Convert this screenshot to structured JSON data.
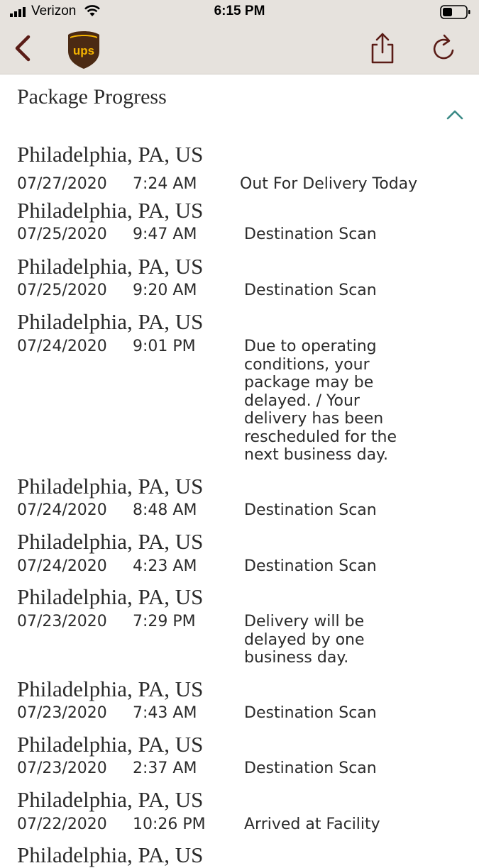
{
  "status_bar": {
    "carrier": "Verizon",
    "time": "6:15 PM"
  },
  "nav": {
    "logo_text": "ups",
    "back_icon": "chevron-left-icon",
    "share_icon": "share-icon",
    "refresh_icon": "refresh-icon"
  },
  "colors": {
    "header_bg": "#e6e2dd",
    "back_arrow": "#5a1c16",
    "ups_brown": "#4b2a13",
    "ups_gold": "#f5b400",
    "accent_teal": "#3b8a86",
    "text": "#2b2b2b"
  },
  "section": {
    "title": "Package Progress",
    "collapse_icon": "chevron-up-icon"
  },
  "events": [
    {
      "location": "Philadelphia, PA, US",
      "date": "07/27/2020",
      "time": "7:24 AM",
      "description": "Out For Delivery Today"
    },
    {
      "location": "Philadelphia, PA, US",
      "date": "07/25/2020",
      "time": "9:47 AM",
      "description": "Destination Scan"
    },
    {
      "location": "Philadelphia, PA, US",
      "date": "07/25/2020",
      "time": "9:20 AM",
      "description": "Destination Scan"
    },
    {
      "location": "Philadelphia, PA, US",
      "date": "07/24/2020",
      "time": "9:01 PM",
      "description": "Due to operating\nconditions, your\npackage may be\ndelayed. / Your\ndelivery has been\nrescheduled for the\nnext business day."
    },
    {
      "location": "Philadelphia, PA, US",
      "date": "07/24/2020",
      "time": "8:48 AM",
      "description": "Destination Scan"
    },
    {
      "location": "Philadelphia, PA, US",
      "date": "07/24/2020",
      "time": "4:23 AM",
      "description": "Destination Scan"
    },
    {
      "location": "Philadelphia, PA, US",
      "date": "07/23/2020",
      "time": "7:29 PM",
      "description": "Delivery will be\ndelayed by one\nbusiness day."
    },
    {
      "location": "Philadelphia, PA, US",
      "date": "07/23/2020",
      "time": "7:43 AM",
      "description": "Destination Scan"
    },
    {
      "location": "Philadelphia, PA, US",
      "date": "07/23/2020",
      "time": "2:37 AM",
      "description": "Destination Scan"
    },
    {
      "location": "Philadelphia, PA, US",
      "date": "07/22/2020",
      "time": "10:26 PM",
      "description": "Arrived at Facility"
    },
    {
      "location": "Philadelphia, PA, US"
    }
  ]
}
